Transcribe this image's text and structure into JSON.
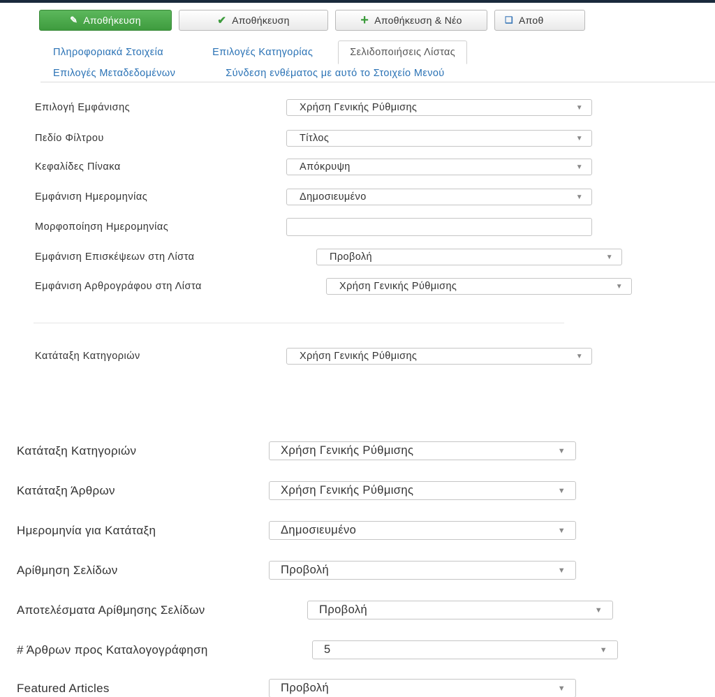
{
  "toolbar": {
    "save_primary": "Αποθήκευση",
    "save": "Αποθήκευση",
    "save_new": "Αποθήκευση & Νέο",
    "save_copy": "Αποθ"
  },
  "tabs": {
    "row1": [
      "Πληροφοριακά Στοιχεία",
      "Επιλογές Κατηγορίας",
      "Σελιδοποιήσεις Λίστας"
    ],
    "row2": [
      "Επιλογές Μεταδεδομένων",
      "Σύνδεση ενθέματος με αυτό το Στοιχείο Μενού"
    ]
  },
  "form_top": [
    {
      "label": "Επιλογή Εμφάνισης",
      "value": "Χρήση Γενικής Ρύθμισης"
    },
    {
      "label": "Πεδίο Φίλτρου",
      "value": "Τίτλος"
    },
    {
      "label": "Κεφαλίδες Πίνακα",
      "value": "Απόκρυψη"
    },
    {
      "label": "Εμφάνιση Ημερομηνίας",
      "value": "Δημοσιευμένο"
    },
    {
      "label": "Μορφοποίηση Ημερομηνίας",
      "value": ""
    },
    {
      "label": "Εμφάνιση Επισκέψεων στη Λίστα",
      "value": "Προβολή"
    },
    {
      "label": "Εμφάνιση Αρθρογράφου στη Λίστα",
      "value": "Χρήση Γενικής Ρύθμισης"
    },
    {
      "label": "Κατάταξη Κατηγοριών",
      "value": "Χρήση Γενικής Ρύθμισης"
    }
  ],
  "form_bottom": [
    {
      "label": "Κατάταξη Κατηγοριών",
      "value": "Χρήση Γενικής Ρύθμισης"
    },
    {
      "label": "Κατάταξη Άρθρων",
      "value": "Χρήση Γενικής Ρύθμισης"
    },
    {
      "label": "Ημερομηνία για Κατάταξη",
      "value": "Δημοσιευμένο"
    },
    {
      "label": "Αρίθμηση Σελίδων",
      "value": "Προβολή"
    },
    {
      "label": "Αποτελέσματα Αρίθμησης Σελίδων",
      "value": "Προβολή"
    },
    {
      "label": "# Άρθρων προς Καταλογογράφηση",
      "value": "5"
    },
    {
      "label": "Featured Articles",
      "value": "Προβολή"
    }
  ]
}
